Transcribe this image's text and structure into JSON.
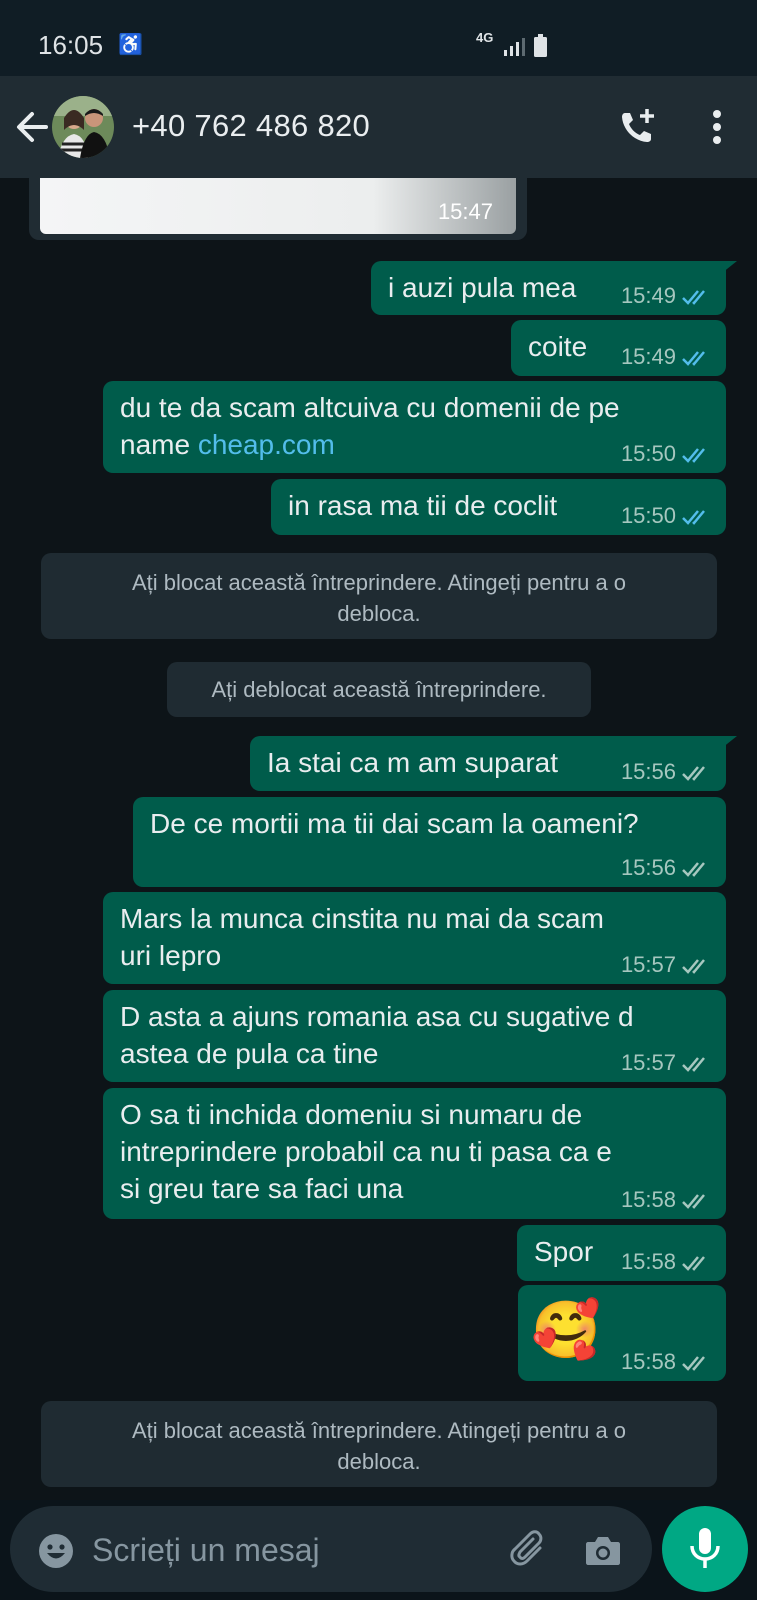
{
  "status_bar": {
    "time": "16:05",
    "network": "4G"
  },
  "header": {
    "contact": "+40 762 486 820",
    "icons": [
      "back-arrow-icon",
      "avatar",
      "add-call-icon",
      "more-vertical-icon"
    ]
  },
  "incoming_image": {
    "time": "15:47"
  },
  "messages": [
    {
      "text": "i auzi pula mea",
      "time": "15:49",
      "status": "read"
    },
    {
      "text": "coite",
      "time": "15:49",
      "status": "read"
    },
    {
      "line1": "du te da scam altcuiva cu domenii de pe",
      "line2_prefix": "name ",
      "link": "cheap.com",
      "time": "15:50",
      "status": "read"
    },
    {
      "text": "in rasa ma tii de coclit",
      "time": "15:50",
      "status": "read"
    },
    {
      "text": "Ia stai ca m am suparat",
      "time": "15:56",
      "status": "delivered"
    },
    {
      "text": "De ce mortii ma tii dai scam la oameni?",
      "time": "15:56",
      "status": "delivered"
    },
    {
      "line1": "Mars la munca cinstita nu mai da scam",
      "line2": "uri lepro",
      "time": "15:57",
      "status": "delivered"
    },
    {
      "line1": "D asta a ajuns romania asa cu sugative d",
      "line2": "astea de pula ca tine",
      "time": "15:57",
      "status": "delivered"
    },
    {
      "line1": "O sa ti inchida domeniu si numaru de",
      "line2": "intreprindere probabil ca nu ti pasa ca e",
      "line3": "si greu tare sa faci una",
      "time": "15:58",
      "status": "delivered"
    },
    {
      "text": "Spor",
      "time": "15:58",
      "status": "delivered"
    },
    {
      "emoji": "🥰",
      "time": "15:58",
      "status": "delivered"
    }
  ],
  "system_notes": {
    "blocked_line1": "Ați blocat această întreprindere. Atingeți pentru a o",
    "blocked_line2": "debloca.",
    "unblocked": "Ați deblocat această întreprindere."
  },
  "composer": {
    "placeholder": "Scrieți un mesaj",
    "icons": [
      "emoji-icon",
      "attach-icon",
      "camera-icon",
      "mic-icon"
    ]
  },
  "colors": {
    "outgoing": "#005c4b",
    "header": "#202c33",
    "background": "#0d1418",
    "read_ticks": "#53bdeb",
    "accent": "#00a884"
  }
}
